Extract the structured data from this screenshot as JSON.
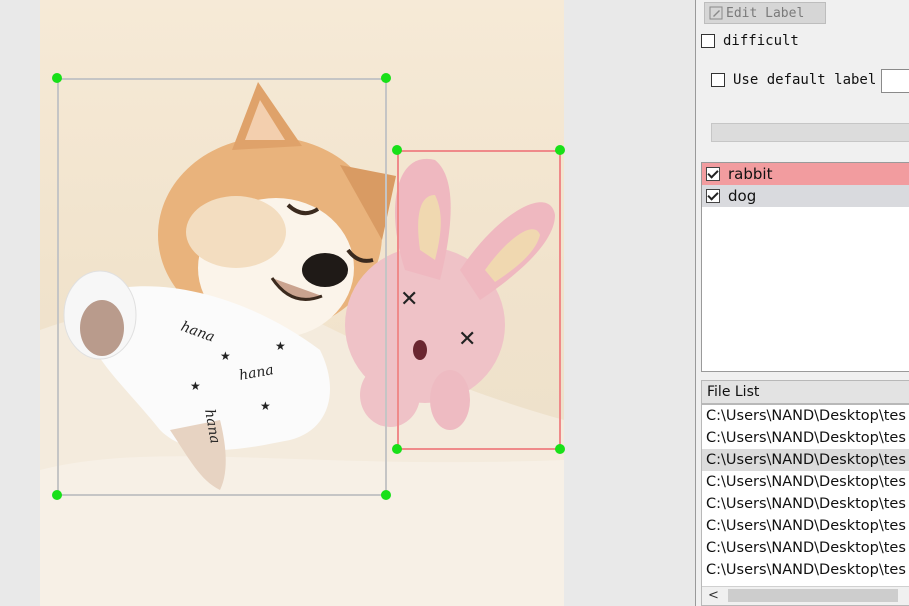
{
  "canvas": {
    "annotations": [
      {
        "label": "dog",
        "color": "#c5c5c5"
      },
      {
        "label": "rabbit",
        "color": "#ef8a8a"
      }
    ],
    "handle_color": "#18e018"
  },
  "dock": {
    "edit_label_button": "Edit Label",
    "difficult_label": "difficult",
    "difficult_checked": false,
    "use_default_label": "Use default label",
    "use_default_checked": false,
    "default_label_value": "",
    "label_list": [
      {
        "label": "rabbit",
        "checked": true,
        "color": "#f29c9f"
      },
      {
        "label": "dog",
        "checked": true,
        "color": "#d9dade"
      }
    ],
    "file_list_title": "File List",
    "files": [
      "C:\\Users\\NAND\\Desktop\\tes",
      "C:\\Users\\NAND\\Desktop\\tes",
      "C:\\Users\\NAND\\Desktop\\tes",
      "C:\\Users\\NAND\\Desktop\\tes",
      "C:\\Users\\NAND\\Desktop\\tes",
      "C:\\Users\\NAND\\Desktop\\tes",
      "C:\\Users\\NAND\\Desktop\\tes",
      "C:\\Users\\NAND\\Desktop\\tes"
    ],
    "selected_file_index": 2,
    "scroll_left_glyph": "<"
  }
}
